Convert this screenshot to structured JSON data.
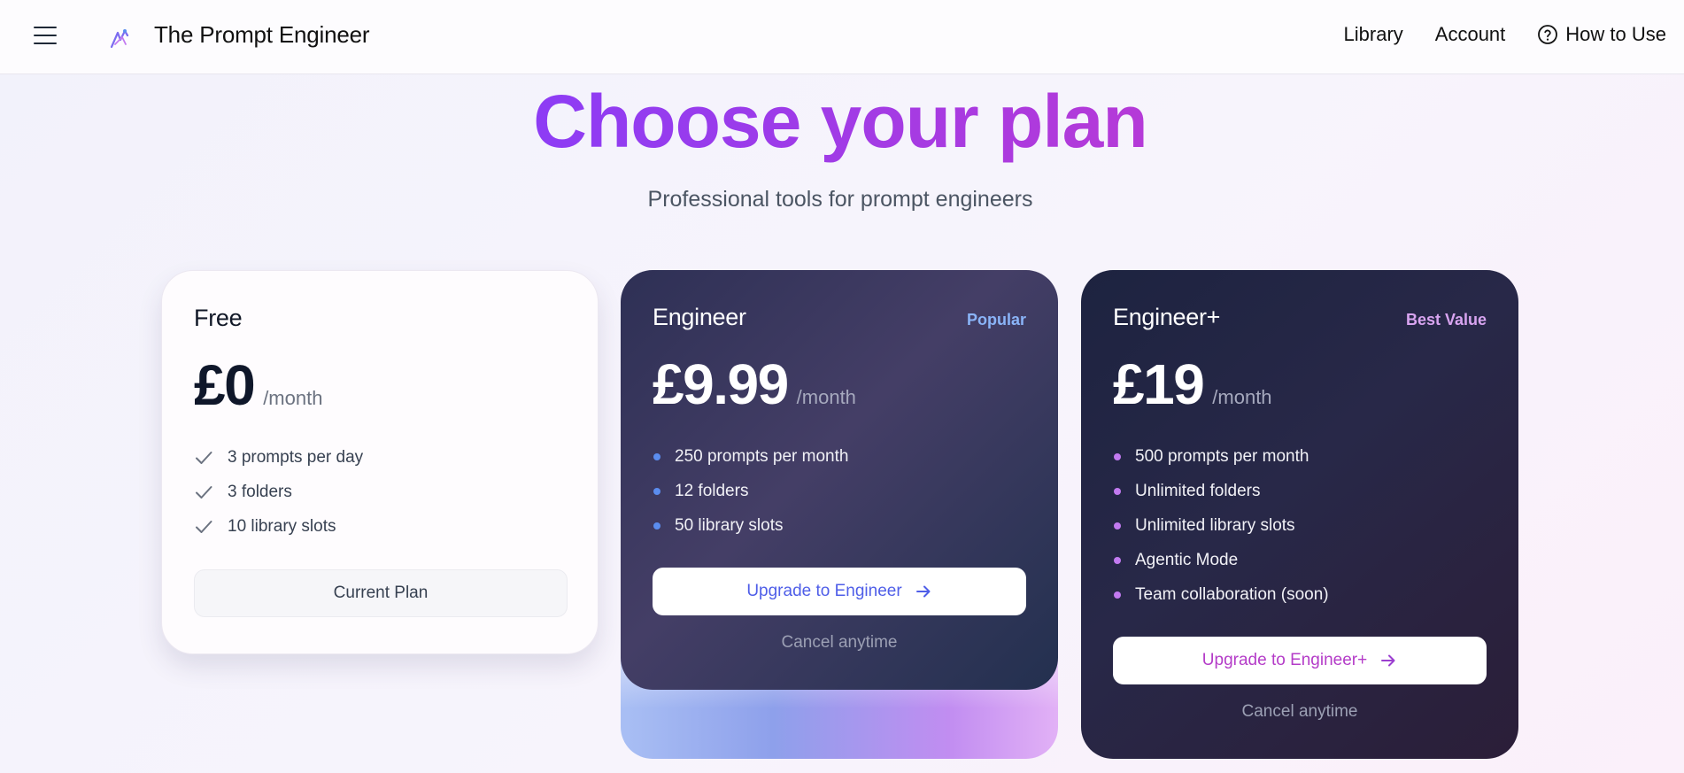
{
  "header": {
    "brand": "The Prompt Engineer",
    "nav": {
      "library": "Library",
      "account": "Account",
      "how_to_use": "How to Use"
    }
  },
  "hero": {
    "title": "Choose your plan",
    "subtitle": "Professional tools for prompt engineers"
  },
  "plans": {
    "free": {
      "name": "Free",
      "price": "£0",
      "period": "/month",
      "features": [
        "3 prompts per day",
        "3 folders",
        "10 library slots"
      ],
      "button": "Current Plan"
    },
    "engineer": {
      "name": "Engineer",
      "badge": "Popular",
      "price": "£9.99",
      "period": "/month",
      "features": [
        "250 prompts per month",
        "12 folders",
        "50 library slots"
      ],
      "button": "Upgrade to Engineer",
      "note": "Cancel anytime"
    },
    "engineer_plus": {
      "name": "Engineer+",
      "badge": "Best Value",
      "price": "£19",
      "period": "/month",
      "features": [
        "500 prompts per month",
        "Unlimited folders",
        "Unlimited library slots",
        "Agentic Mode",
        "Team collaboration (soon)"
      ],
      "button": "Upgrade to Engineer+",
      "note": "Cancel anytime"
    }
  },
  "colors": {
    "title_gradient_start": "#8b3cf6",
    "title_gradient_end": "#b73ad6",
    "engineer_accent": "#4f5ee8",
    "engineer_plus_accent": "#b43cc8",
    "popular_badge": "#8ab4f8",
    "best_value_badge": "#d8a4f0"
  },
  "icons": {
    "menu": "hamburger-menu-icon",
    "logo": "logo-icon",
    "help": "question-circle-icon",
    "feature_free": "check-icon",
    "feature_paid": "bullet-dot-icon",
    "button_arrow": "arrow-right-icon"
  }
}
